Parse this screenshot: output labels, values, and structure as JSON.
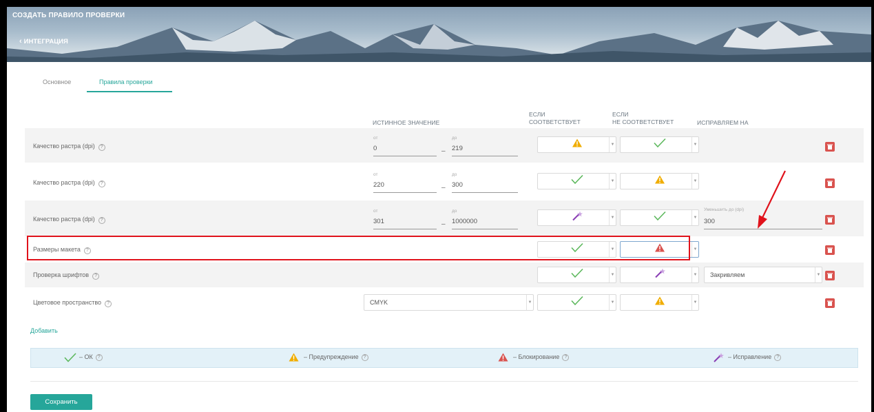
{
  "header": {
    "title": "СОЗДАТЬ ПРАВИЛО ПРОВЕРКИ",
    "back_link": "ИНТЕГРАЦИЯ"
  },
  "tabs": [
    {
      "label": "Основное",
      "active": false
    },
    {
      "label": "Правила проверки",
      "active": true
    }
  ],
  "columns": {
    "true_value": "ИСТИННОЕ ЗНАЧЕНИЕ",
    "if_match_1": "ЕСЛИ",
    "if_match_2": "СООТВЕТСТВУЕТ",
    "if_not_match_1": "ЕСЛИ",
    "if_not_match_2": "НЕ СООТВЕТСТВУЕТ",
    "fix_to": "ИСПРАВЛЯЕМ НА"
  },
  "range_labels": {
    "from": "от",
    "to": "до",
    "dash": "–"
  },
  "rows": [
    {
      "label": "Качество растра (dpi)",
      "from": "0",
      "to": "219",
      "if_match": "warning",
      "if_not_match": "ok",
      "fix_label": "",
      "fix_value": ""
    },
    {
      "label": "Качество растра (dpi)",
      "from": "220",
      "to": "300",
      "if_match": "ok",
      "if_not_match": "warning",
      "fix_label": "",
      "fix_value": ""
    },
    {
      "label": "Качество растра (dpi)",
      "from": "301",
      "to": "1000000",
      "if_match": "fix",
      "if_not_match": "ok",
      "fix_label": "Уменьшить до (dpi)",
      "fix_value": "300"
    },
    {
      "label": "Размеры макета",
      "if_match": "ok",
      "if_not_match": "block"
    },
    {
      "label": "Проверка шрифтов",
      "if_match": "ok",
      "if_not_match": "fix",
      "fix_select": "Закривляем"
    },
    {
      "label": "Цветовое пространство",
      "value_select": "CMYK",
      "if_match": "ok",
      "if_not_match": "warning"
    }
  ],
  "add_link": "Добавить",
  "legend": [
    {
      "icon": "check-icon",
      "text": "– ОК"
    },
    {
      "icon": "warning-icon",
      "text": "– Предупреждение"
    },
    {
      "icon": "block-icon",
      "text": "– Блокирование"
    },
    {
      "icon": "magic-wand-icon",
      "text": "– Исправление"
    }
  ],
  "help_glyph": "?",
  "save_label": "Сохранить",
  "colors": {
    "accent": "#26a69a",
    "ok": "#5cb85c",
    "warning": "#f0ad00",
    "block": "#d9534f",
    "fix": "#8a3fb5",
    "annotation": "#e0121b"
  }
}
